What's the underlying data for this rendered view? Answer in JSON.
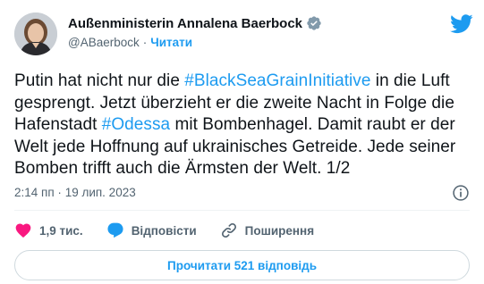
{
  "author": {
    "name": "Außenministerin Annalena Baerbock",
    "handle": "@ABaerbock",
    "separator": "·",
    "follow_label": "Читати"
  },
  "tweet": {
    "segments": [
      {
        "text": "Putin hat nicht nur die ",
        "tag": false
      },
      {
        "text": "#BlackSeaGrainInitiative",
        "tag": true
      },
      {
        "text": " in die Luft gesprengt. Jetzt überzieht er die zweite Nacht in Folge die Hafenstadt ",
        "tag": false
      },
      {
        "text": "#Odessa",
        "tag": true
      },
      {
        "text": " mit Bombenhagel. Damit raubt er der Welt jede Hoffnung auf ukrainisches Getreide. Jede seiner Bomben trifft auch die Ärmsten der Welt. 1/2",
        "tag": false
      }
    ],
    "time": "2:14 пп",
    "date_separator": "·",
    "date": "19 лип. 2023"
  },
  "actions": {
    "likes": "1,9 тис.",
    "reply_label": "Відповісти",
    "share_label": "Поширення"
  },
  "read_replies_label": "Прочитати 521 відповідь",
  "colors": {
    "accent": "#1d9bf0",
    "like": "#f91880",
    "text": "#0f1419",
    "muted": "#536471"
  },
  "icons": [
    "twitter-logo-icon",
    "verified-badge-icon",
    "info-icon",
    "heart-icon",
    "reply-bubble-icon",
    "share-link-icon"
  ]
}
